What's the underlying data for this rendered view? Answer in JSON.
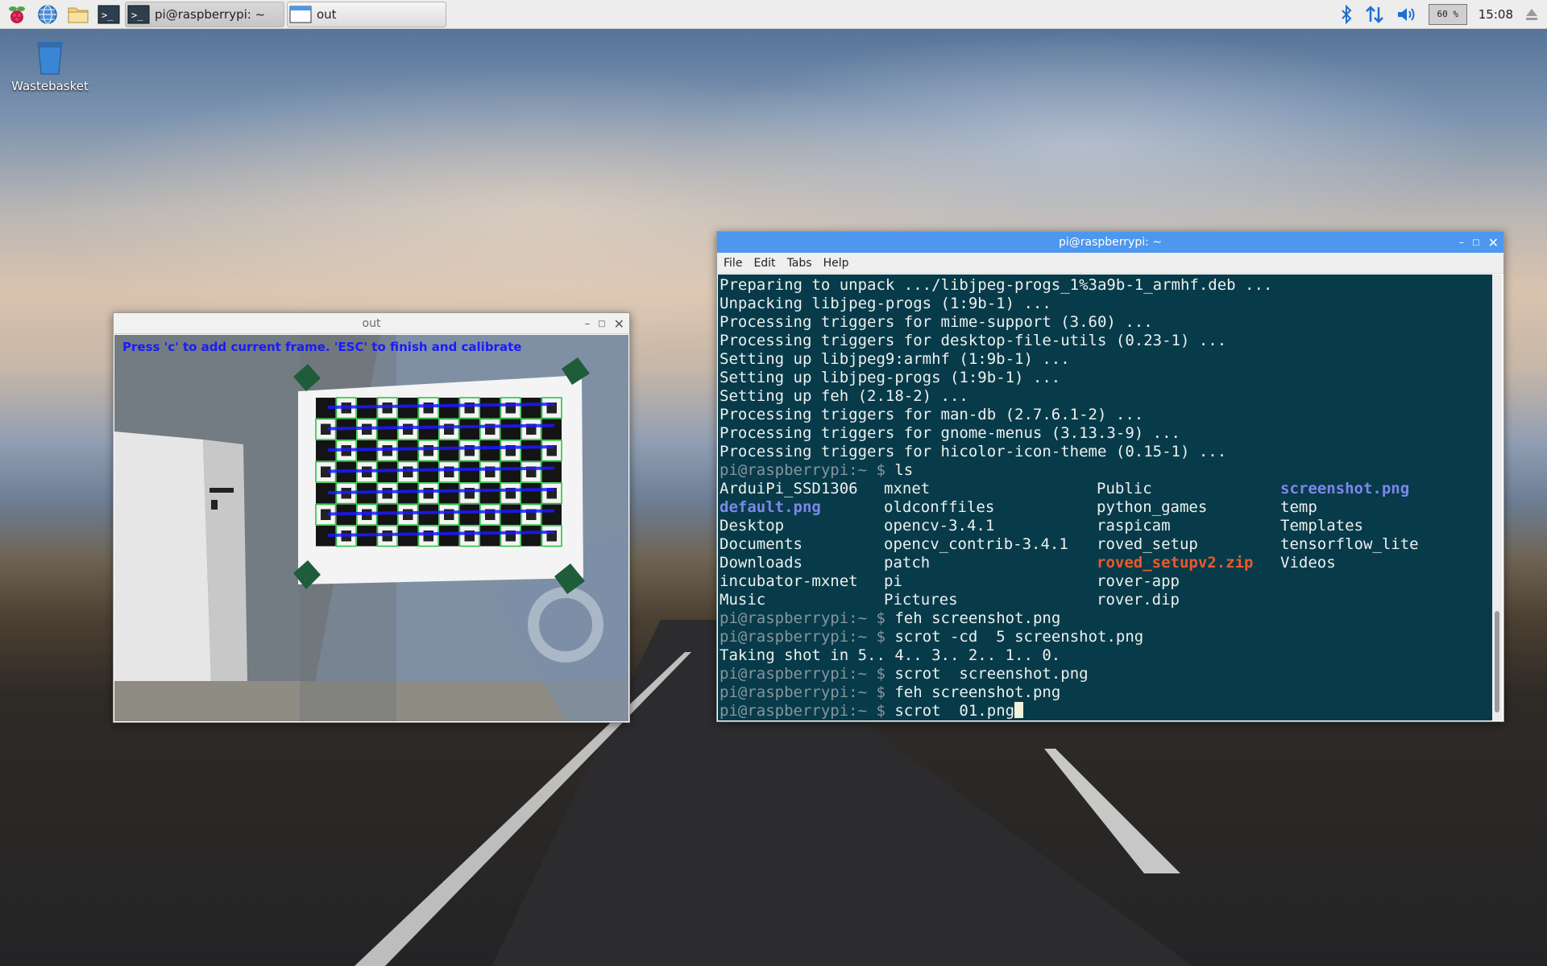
{
  "taskbar": {
    "launchers": [
      {
        "name": "raspberry-menu",
        "icon": "raspberry-icon"
      },
      {
        "name": "web-browser",
        "icon": "globe-icon"
      },
      {
        "name": "file-manager",
        "icon": "folder-icon"
      },
      {
        "name": "terminal",
        "icon": "terminal-icon"
      }
    ],
    "tasks": [
      {
        "label": "pi@raspberrypi: ~",
        "icon": "terminal-icon"
      },
      {
        "label": "out",
        "icon": "window-icon"
      }
    ],
    "tray": {
      "cpu": "60 %",
      "clock": "15:08"
    }
  },
  "desktop": {
    "icons": [
      {
        "label": "Wastebasket",
        "icon": "trash-icon"
      }
    ]
  },
  "out_window": {
    "title": "out",
    "overlay_text": "Press 'c' to add current frame. 'ESC' to finish and calibrate"
  },
  "terminal": {
    "title": "pi@raspberrypi: ~",
    "menu": [
      "File",
      "Edit",
      "Tabs",
      "Help"
    ],
    "prompt": "pi@raspberrypi",
    "prompt_suffix": ":~ $ ",
    "lines_before": [
      "Preparing to unpack .../libjpeg-progs_1%3a9b-1_armhf.deb ...",
      "Unpacking libjpeg-progs (1:9b-1) ...",
      "Processing triggers for mime-support (3.60) ...",
      "Processing triggers for desktop-file-utils (0.23-1) ...",
      "Setting up libjpeg9:armhf (1:9b-1) ...",
      "Setting up libjpeg-progs (1:9b-1) ...",
      "Setting up feh (2.18-2) ...",
      "Processing triggers for man-db (2.7.6.1-2) ...",
      "Processing triggers for gnome-menus (3.13.3-9) ...",
      "Processing triggers for hicolor-icon-theme (0.15-1) ..."
    ],
    "ls_command": "ls",
    "ls_rows": [
      [
        "ArduiPi_SSD1306",
        "mxnet",
        "Public",
        "screenshot.png"
      ],
      [
        "default.png",
        "oldconffiles",
        "python_games",
        "temp"
      ],
      [
        "Desktop",
        "opencv-3.4.1",
        "raspicam",
        "Templates"
      ],
      [
        "Documents",
        "opencv_contrib-3.4.1",
        "roved_setup",
        "tensorflow_lite"
      ],
      [
        "Downloads",
        "patch",
        "roved_setupv2.zip",
        "Videos"
      ],
      [
        "incubator-mxnet",
        "pi",
        "rover-app",
        ""
      ],
      [
        "Music",
        "Pictures",
        "rover.dip",
        ""
      ]
    ],
    "ls_colors": {
      "screenshot.png": "blue",
      "default.png": "blue",
      "roved_setupv2.zip": "orange"
    },
    "cmd1": "feh screenshot.png",
    "cmd2": "scrot -cd  5 screenshot.png",
    "countdown": "Taking shot in 5.. 4.. 3.. 2.. 1.. 0.",
    "cmd3": "scrot  screenshot.png",
    "cmd4": "feh screenshot.png",
    "cmd5": "scrot  01.png",
    "colors": {
      "background": "#073b4a",
      "foreground": "#eef0ee",
      "prompt": "#8a949c",
      "image_file": "#7e86e8",
      "archive_file": "#ea5a2a",
      "titlebar": "#4d97ef"
    }
  }
}
